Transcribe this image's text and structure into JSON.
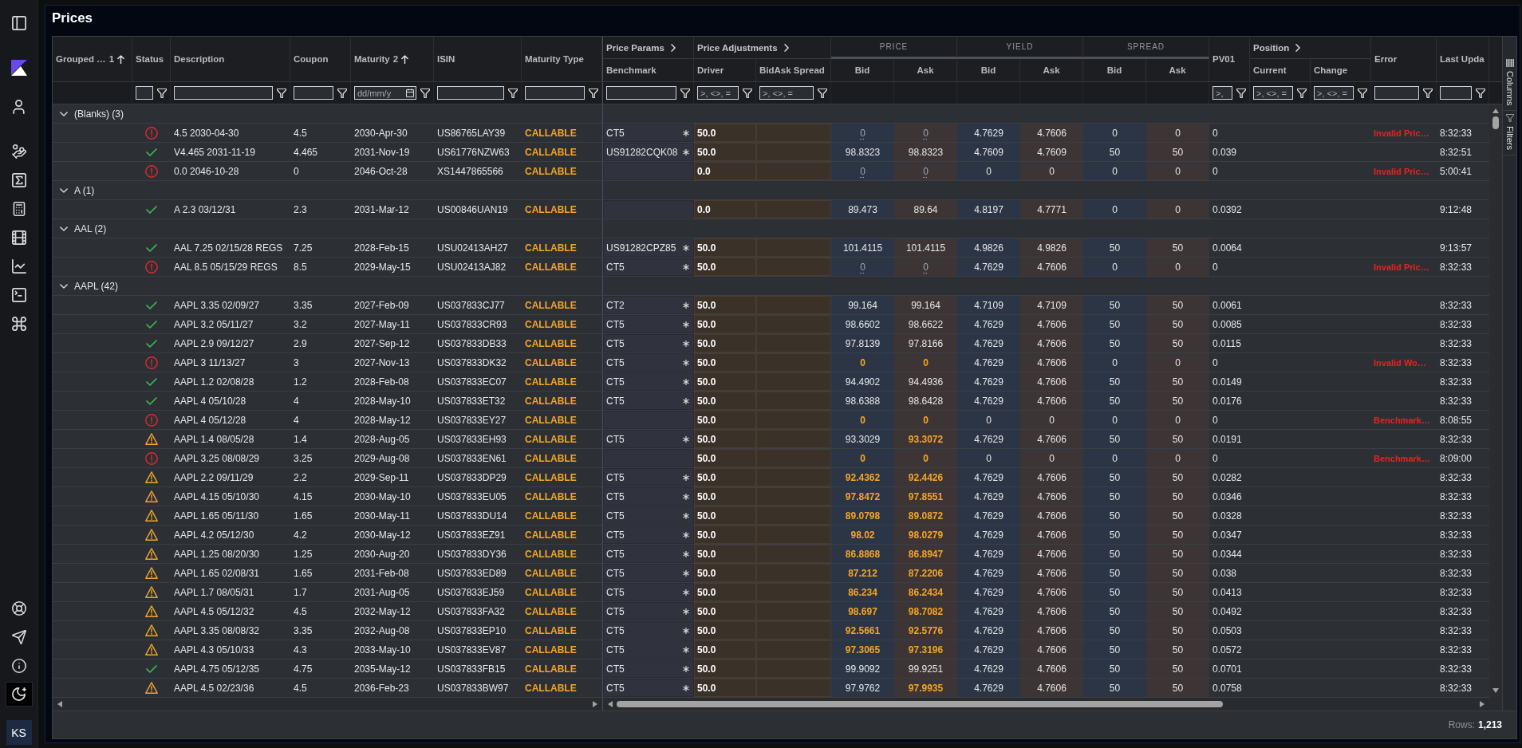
{
  "sidebar": {
    "avatar": "KS"
  },
  "page": {
    "title": "Prices"
  },
  "grid": {
    "pinned_columns": [
      {
        "label": "Grouped …",
        "sort": {
          "kind": "ascending",
          "index": "1"
        }
      },
      {
        "label": "Status",
        "filter": {
          "kind": "text"
        }
      },
      {
        "label": "Description",
        "filter": {
          "kind": "text"
        }
      },
      {
        "label": "Coupon",
        "filter": {
          "kind": "text"
        }
      },
      {
        "label": "Maturity",
        "sort": {
          "kind": "ascending",
          "index": "2"
        },
        "filter": {
          "kind": "date",
          "placeholder": "dd/mm/y"
        }
      },
      {
        "label": "ISIN",
        "filter": {
          "kind": "text"
        }
      },
      {
        "label": "Maturity Type",
        "filter": {
          "kind": "text"
        }
      }
    ],
    "column_groups": [
      {
        "label": "Price Params",
        "kind": "expandable",
        "columns": [
          {
            "label": "Benchmark",
            "filter": {
              "kind": "text"
            }
          }
        ]
      },
      {
        "label": "Price Adjustments",
        "kind": "expandable",
        "columns": [
          {
            "label": "Driver",
            "filter": {
              "kind": "text",
              "placeholder": ">, <>, ="
            }
          },
          {
            "label": "BidAsk Spread",
            "filter": {
              "kind": "text",
              "placeholder": ">, <>, ="
            }
          }
        ]
      },
      {
        "label": "PRICE",
        "kind": "band",
        "columns": [
          {
            "label": "Bid"
          },
          {
            "label": "Ask"
          }
        ]
      },
      {
        "label": "YIELD",
        "kind": "band",
        "columns": [
          {
            "label": "Bid"
          },
          {
            "label": "Ask"
          }
        ]
      },
      {
        "label": "SPREAD",
        "kind": "band",
        "columns": [
          {
            "label": "Bid"
          },
          {
            "label": "Ask"
          }
        ]
      },
      {
        "label": "PV01",
        "kind": "single",
        "filter": {
          "kind": "text",
          "placeholder": ">,"
        }
      },
      {
        "label": "Position",
        "kind": "expandable",
        "columns": [
          {
            "label": "Current",
            "filter": {
              "kind": "text",
              "placeholder": ">, <>, ="
            }
          },
          {
            "label": "Change",
            "filter": {
              "kind": "text",
              "placeholder": ">, <>, ="
            }
          }
        ]
      },
      {
        "label": "Error",
        "kind": "single",
        "filter": {
          "kind": "text"
        }
      },
      {
        "label": "Last Upda",
        "kind": "single",
        "filter": {
          "kind": "text"
        }
      }
    ],
    "groups": [
      {
        "label": "(Blanks) (3)",
        "expanded": true,
        "rows": [
          {
            "status": {
              "kind": "error"
            },
            "description": "4.5 2030-04-30",
            "coupon": "4.5",
            "maturity": "2030-Apr-30",
            "isin": "US86765LAY39",
            "maturity_type": "CALLABLE",
            "benchmark": "CT5",
            "driver": "50.0",
            "price_bid": {
              "text": "0",
              "kind": "dotted"
            },
            "price_ask": {
              "text": "0",
              "kind": "dotted"
            },
            "yield_bid": "4.7629",
            "yield_ask": "4.7606",
            "spread_bid": "0",
            "spread_ask": "0",
            "pv01": "0",
            "error": "Invalid Pric…",
            "last_update": "8:32:33"
          },
          {
            "status": {
              "kind": "ok"
            },
            "description": "V4.465 2031-11-19",
            "coupon": "4.465",
            "maturity": "2031-Nov-19",
            "isin": "US61776NZW63",
            "maturity_type": "CALLABLE",
            "benchmark": "US91282CQK08",
            "driver": "50.0",
            "price_bid": {
              "text": "98.8323",
              "kind": "plain"
            },
            "price_ask": {
              "text": "98.8323",
              "kind": "plain"
            },
            "yield_bid": "4.7609",
            "yield_ask": "4.7609",
            "spread_bid": "50",
            "spread_ask": "50",
            "pv01": "0.039",
            "last_update": "8:32:51"
          },
          {
            "status": {
              "kind": "error"
            },
            "description": "0.0 2046-10-28",
            "coupon": "0",
            "maturity": "2046-Oct-28",
            "isin": "XS1447865566",
            "maturity_type": "CALLABLE",
            "driver": "0.0",
            "price_bid": {
              "text": "0",
              "kind": "dotted"
            },
            "price_ask": {
              "text": "0",
              "kind": "dotted"
            },
            "yield_bid": "0",
            "yield_ask": "0",
            "spread_bid": "0",
            "spread_ask": "0",
            "pv01": "0",
            "error": "Invalid Pric…",
            "last_update": "5:00:41"
          }
        ]
      },
      {
        "label": "A (1)",
        "expanded": true,
        "rows": [
          {
            "status": {
              "kind": "ok"
            },
            "description": "A 2.3 03/12/31",
            "coupon": "2.3",
            "maturity": "2031-Mar-12",
            "isin": "US00846UAN19",
            "maturity_type": "CALLABLE",
            "driver": "0.0",
            "price_bid": {
              "text": "89.473",
              "kind": "plain"
            },
            "price_ask": {
              "text": "89.64",
              "kind": "plain"
            },
            "yield_bid": "4.8197",
            "yield_ask": "4.7771",
            "spread_bid": "0",
            "spread_ask": "0",
            "pv01": "0.0392",
            "last_update": "9:12:48"
          }
        ]
      },
      {
        "label": "AAL (2)",
        "expanded": true,
        "rows": [
          {
            "status": {
              "kind": "ok"
            },
            "description": "AAL 7.25 02/15/28 REGS",
            "coupon": "7.25",
            "maturity": "2028-Feb-15",
            "isin": "USU02413AH27",
            "maturity_type": "CALLABLE",
            "benchmark": "US91282CPZ85",
            "driver": "50.0",
            "price_bid": {
              "text": "101.4115",
              "kind": "plain"
            },
            "price_ask": {
              "text": "101.4115",
              "kind": "plain"
            },
            "yield_bid": "4.9826",
            "yield_ask": "4.9826",
            "spread_bid": "50",
            "spread_ask": "50",
            "pv01": "0.0064",
            "last_update": "9:13:57"
          },
          {
            "status": {
              "kind": "error"
            },
            "description": "AAL 8.5 05/15/29 REGS",
            "coupon": "8.5",
            "maturity": "2029-May-15",
            "isin": "USU02413AJ82",
            "maturity_type": "CALLABLE",
            "benchmark": "CT5",
            "driver": "50.0",
            "price_bid": {
              "text": "0",
              "kind": "dotted"
            },
            "price_ask": {
              "text": "0",
              "kind": "dotted"
            },
            "yield_bid": "4.7629",
            "yield_ask": "4.7606",
            "spread_bid": "0",
            "spread_ask": "0",
            "pv01": "0",
            "error": "Invalid Pric…",
            "last_update": "8:32:33"
          }
        ]
      },
      {
        "label": "AAPL (42)",
        "expanded": true,
        "rows": [
          {
            "status": {
              "kind": "ok"
            },
            "description": "AAPL 3.35 02/09/27",
            "coupon": "3.35",
            "maturity": "2027-Feb-09",
            "isin": "US037833CJ77",
            "maturity_type": "CALLABLE",
            "benchmark": "CT2",
            "driver": "50.0",
            "price_bid": {
              "text": "99.164",
              "kind": "plain"
            },
            "price_ask": {
              "text": "99.164",
              "kind": "plain"
            },
            "yield_bid": "4.7109",
            "yield_ask": "4.7109",
            "spread_bid": "50",
            "spread_ask": "50",
            "pv01": "0.0061",
            "last_update": "8:32:33"
          },
          {
            "status": {
              "kind": "ok"
            },
            "description": "AAPL 3.2 05/11/27",
            "coupon": "3.2",
            "maturity": "2027-May-11",
            "isin": "US037833CR93",
            "maturity_type": "CALLABLE",
            "benchmark": "CT5",
            "driver": "50.0",
            "price_bid": {
              "text": "98.6602",
              "kind": "plain"
            },
            "price_ask": {
              "text": "98.6622",
              "kind": "plain"
            },
            "yield_bid": "4.7629",
            "yield_ask": "4.7606",
            "spread_bid": "50",
            "spread_ask": "50",
            "pv01": "0.0085",
            "last_update": "8:32:33"
          },
          {
            "status": {
              "kind": "ok"
            },
            "description": "AAPL 2.9 09/12/27",
            "coupon": "2.9",
            "maturity": "2027-Sep-12",
            "isin": "US037833DB33",
            "maturity_type": "CALLABLE",
            "benchmark": "CT5",
            "driver": "50.0",
            "price_bid": {
              "text": "97.8139",
              "kind": "plain"
            },
            "price_ask": {
              "text": "97.8166",
              "kind": "plain"
            },
            "yield_bid": "4.7629",
            "yield_ask": "4.7606",
            "spread_bid": "50",
            "spread_ask": "50",
            "pv01": "0.0115",
            "last_update": "8:32:33"
          },
          {
            "status": {
              "kind": "error"
            },
            "description": "AAPL 3 11/13/27",
            "coupon": "3",
            "maturity": "2027-Nov-13",
            "isin": "US037833DK32",
            "maturity_type": "CALLABLE",
            "benchmark": "CT5",
            "driver": "50.0",
            "price_bid": {
              "text": "0",
              "kind": "warning"
            },
            "price_ask": {
              "text": "0",
              "kind": "warning"
            },
            "yield_bid": "4.7629",
            "yield_ask": "4.7606",
            "spread_bid": "0",
            "spread_ask": "0",
            "pv01": "0",
            "error": "Invalid Wo…",
            "last_update": "8:32:33"
          },
          {
            "status": {
              "kind": "ok"
            },
            "description": "AAPL 1.2 02/08/28",
            "coupon": "1.2",
            "maturity": "2028-Feb-08",
            "isin": "US037833EC07",
            "maturity_type": "CALLABLE",
            "benchmark": "CT5",
            "driver": "50.0",
            "price_bid": {
              "text": "94.4902",
              "kind": "plain"
            },
            "price_ask": {
              "text": "94.4936",
              "kind": "plain"
            },
            "yield_bid": "4.7629",
            "yield_ask": "4.7606",
            "spread_bid": "50",
            "spread_ask": "50",
            "pv01": "0.0149",
            "last_update": "8:32:33"
          },
          {
            "status": {
              "kind": "ok"
            },
            "description": "AAPL 4 05/10/28",
            "coupon": "4",
            "maturity": "2028-May-10",
            "isin": "US037833ET32",
            "maturity_type": "CALLABLE",
            "benchmark": "CT5",
            "driver": "50.0",
            "price_bid": {
              "text": "98.6388",
              "kind": "plain"
            },
            "price_ask": {
              "text": "98.6428",
              "kind": "plain"
            },
            "yield_bid": "4.7629",
            "yield_ask": "4.7606",
            "spread_bid": "50",
            "spread_ask": "50",
            "pv01": "0.0176",
            "last_update": "8:32:33"
          },
          {
            "status": {
              "kind": "error"
            },
            "description": "AAPL 4 05/12/28",
            "coupon": "4",
            "maturity": "2028-May-12",
            "isin": "US037833EY27",
            "maturity_type": "CALLABLE",
            "driver": "50.0",
            "price_bid": {
              "text": "0",
              "kind": "warning"
            },
            "price_ask": {
              "text": "0",
              "kind": "warning"
            },
            "yield_bid": "0",
            "yield_ask": "0",
            "spread_bid": "0",
            "spread_ask": "0",
            "pv01": "0",
            "error": "Benchmark…",
            "last_update": "8:08:55"
          },
          {
            "status": {
              "kind": "warning"
            },
            "description": "AAPL 1.4 08/05/28",
            "coupon": "1.4",
            "maturity": "2028-Aug-05",
            "isin": "US037833EH93",
            "maturity_type": "CALLABLE",
            "benchmark": "CT5",
            "driver": "50.0",
            "price_bid": {
              "text": "93.3029",
              "kind": "plain"
            },
            "price_ask": {
              "text": "93.3072",
              "kind": "warning"
            },
            "yield_bid": "4.7629",
            "yield_ask": "4.7606",
            "spread_bid": "50",
            "spread_ask": "50",
            "pv01": "0.0191",
            "last_update": "8:32:33"
          },
          {
            "status": {
              "kind": "error"
            },
            "description": "AAPL 3.25 08/08/29",
            "coupon": "3.25",
            "maturity": "2029-Aug-08",
            "isin": "US037833EN61",
            "maturity_type": "CALLABLE",
            "driver": "50.0",
            "price_bid": {
              "text": "0",
              "kind": "warning"
            },
            "price_ask": {
              "text": "0",
              "kind": "warning"
            },
            "yield_bid": "0",
            "yield_ask": "0",
            "spread_bid": "0",
            "spread_ask": "0",
            "pv01": "0",
            "error": "Benchmark…",
            "last_update": "8:09:00"
          },
          {
            "status": {
              "kind": "warning"
            },
            "description": "AAPL 2.2 09/11/29",
            "coupon": "2.2",
            "maturity": "2029-Sep-11",
            "isin": "US037833DP29",
            "maturity_type": "CALLABLE",
            "benchmark": "CT5",
            "driver": "50.0",
            "price_bid": {
              "text": "92.4362",
              "kind": "warning"
            },
            "price_ask": {
              "text": "92.4426",
              "kind": "warning"
            },
            "yield_bid": "4.7629",
            "yield_ask": "4.7606",
            "spread_bid": "50",
            "spread_ask": "50",
            "pv01": "0.0282",
            "last_update": "8:32:33"
          },
          {
            "status": {
              "kind": "warning"
            },
            "description": "AAPL 4.15 05/10/30",
            "coupon": "4.15",
            "maturity": "2030-May-10",
            "isin": "US037833EU05",
            "maturity_type": "CALLABLE",
            "benchmark": "CT5",
            "driver": "50.0",
            "price_bid": {
              "text": "97.8472",
              "kind": "warning"
            },
            "price_ask": {
              "text": "97.8551",
              "kind": "warning"
            },
            "yield_bid": "4.7629",
            "yield_ask": "4.7606",
            "spread_bid": "50",
            "spread_ask": "50",
            "pv01": "0.0346",
            "last_update": "8:32:33"
          },
          {
            "status": {
              "kind": "warning"
            },
            "description": "AAPL 1.65 05/11/30",
            "coupon": "1.65",
            "maturity": "2030-May-11",
            "isin": "US037833DU14",
            "maturity_type": "CALLABLE",
            "benchmark": "CT5",
            "driver": "50.0",
            "price_bid": {
              "text": "89.0798",
              "kind": "warning"
            },
            "price_ask": {
              "text": "89.0872",
              "kind": "warning"
            },
            "yield_bid": "4.7629",
            "yield_ask": "4.7606",
            "spread_bid": "50",
            "spread_ask": "50",
            "pv01": "0.0328",
            "last_update": "8:32:33"
          },
          {
            "status": {
              "kind": "warning"
            },
            "description": "AAPL 4.2 05/12/30",
            "coupon": "4.2",
            "maturity": "2030-May-12",
            "isin": "US037833EZ91",
            "maturity_type": "CALLABLE",
            "benchmark": "CT5",
            "driver": "50.0",
            "price_bid": {
              "text": "98.02",
              "kind": "warning"
            },
            "price_ask": {
              "text": "98.0279",
              "kind": "warning"
            },
            "yield_bid": "4.7629",
            "yield_ask": "4.7606",
            "spread_bid": "50",
            "spread_ask": "50",
            "pv01": "0.0347",
            "last_update": "8:32:33"
          },
          {
            "status": {
              "kind": "warning"
            },
            "description": "AAPL 1.25 08/20/30",
            "coupon": "1.25",
            "maturity": "2030-Aug-20",
            "isin": "US037833DY36",
            "maturity_type": "CALLABLE",
            "benchmark": "CT5",
            "driver": "50.0",
            "price_bid": {
              "text": "86.8868",
              "kind": "warning"
            },
            "price_ask": {
              "text": "86.8947",
              "kind": "warning"
            },
            "yield_bid": "4.7629",
            "yield_ask": "4.7606",
            "spread_bid": "50",
            "spread_ask": "50",
            "pv01": "0.0344",
            "last_update": "8:32:33"
          },
          {
            "status": {
              "kind": "warning"
            },
            "description": "AAPL 1.65 02/08/31",
            "coupon": "1.65",
            "maturity": "2031-Feb-08",
            "isin": "US037833ED89",
            "maturity_type": "CALLABLE",
            "benchmark": "CT5",
            "driver": "50.0",
            "price_bid": {
              "text": "87.212",
              "kind": "warning"
            },
            "price_ask": {
              "text": "87.2206",
              "kind": "warning"
            },
            "yield_bid": "4.7629",
            "yield_ask": "4.7606",
            "spread_bid": "50",
            "spread_ask": "50",
            "pv01": "0.038",
            "last_update": "8:32:33"
          },
          {
            "status": {
              "kind": "warning"
            },
            "description": "AAPL 1.7 08/05/31",
            "coupon": "1.7",
            "maturity": "2031-Aug-05",
            "isin": "US037833EJ59",
            "maturity_type": "CALLABLE",
            "benchmark": "CT5",
            "driver": "50.0",
            "price_bid": {
              "text": "86.234",
              "kind": "warning"
            },
            "price_ask": {
              "text": "86.2434",
              "kind": "warning"
            },
            "yield_bid": "4.7629",
            "yield_ask": "4.7606",
            "spread_bid": "50",
            "spread_ask": "50",
            "pv01": "0.0413",
            "last_update": "8:32:33"
          },
          {
            "status": {
              "kind": "warning"
            },
            "description": "AAPL 4.5 05/12/32",
            "coupon": "4.5",
            "maturity": "2032-May-12",
            "isin": "US037833FA32",
            "maturity_type": "CALLABLE",
            "benchmark": "CT5",
            "driver": "50.0",
            "price_bid": {
              "text": "98.697",
              "kind": "warning"
            },
            "price_ask": {
              "text": "98.7082",
              "kind": "warning"
            },
            "yield_bid": "4.7629",
            "yield_ask": "4.7606",
            "spread_bid": "50",
            "spread_ask": "50",
            "pv01": "0.0492",
            "last_update": "8:32:33"
          },
          {
            "status": {
              "kind": "warning"
            },
            "description": "AAPL 3.35 08/08/32",
            "coupon": "3.35",
            "maturity": "2032-Aug-08",
            "isin": "US037833EP10",
            "maturity_type": "CALLABLE",
            "benchmark": "CT5",
            "driver": "50.0",
            "price_bid": {
              "text": "92.5661",
              "kind": "warning"
            },
            "price_ask": {
              "text": "92.5776",
              "kind": "warning"
            },
            "yield_bid": "4.7629",
            "yield_ask": "4.7606",
            "spread_bid": "50",
            "spread_ask": "50",
            "pv01": "0.0503",
            "last_update": "8:32:33"
          },
          {
            "status": {
              "kind": "warning"
            },
            "description": "AAPL 4.3 05/10/33",
            "coupon": "4.3",
            "maturity": "2033-May-10",
            "isin": "US037833EV87",
            "maturity_type": "CALLABLE",
            "benchmark": "CT5",
            "driver": "50.0",
            "price_bid": {
              "text": "97.3065",
              "kind": "warning"
            },
            "price_ask": {
              "text": "97.3196",
              "kind": "warning"
            },
            "yield_bid": "4.7629",
            "yield_ask": "4.7606",
            "spread_bid": "50",
            "spread_ask": "50",
            "pv01": "0.0572",
            "last_update": "8:32:33"
          },
          {
            "status": {
              "kind": "ok"
            },
            "description": "AAPL 4.75 05/12/35",
            "coupon": "4.75",
            "maturity": "2035-May-12",
            "isin": "US037833FB15",
            "maturity_type": "CALLABLE",
            "benchmark": "CT5",
            "driver": "50.0",
            "price_bid": {
              "text": "99.9092",
              "kind": "plain"
            },
            "price_ask": {
              "text": "99.9251",
              "kind": "plain"
            },
            "yield_bid": "4.7629",
            "yield_ask": "4.7606",
            "spread_bid": "50",
            "spread_ask": "50",
            "pv01": "0.0701",
            "last_update": "8:32:33"
          },
          {
            "status": {
              "kind": "warning"
            },
            "description": "AAPL 4.5 02/23/36",
            "coupon": "4.5",
            "maturity": "2036-Feb-23",
            "isin": "US037833BW97",
            "maturity_type": "CALLABLE",
            "benchmark": "CT5",
            "driver": "50.0",
            "price_bid": {
              "text": "97.9762",
              "kind": "plain"
            },
            "price_ask": {
              "text": "97.9935",
              "kind": "warning"
            },
            "yield_bid": "4.7629",
            "yield_ask": "4.7606",
            "spread_bid": "50",
            "spread_ask": "50",
            "pv01": "0.0758",
            "last_update": "8:32:33"
          }
        ]
      }
    ],
    "tool_panels": [
      {
        "label": "Columns",
        "kind": "columns"
      },
      {
        "label": "Filters",
        "kind": "filters"
      }
    ],
    "status_bar": {
      "label": "Rows:",
      "value": "1,213"
    }
  }
}
